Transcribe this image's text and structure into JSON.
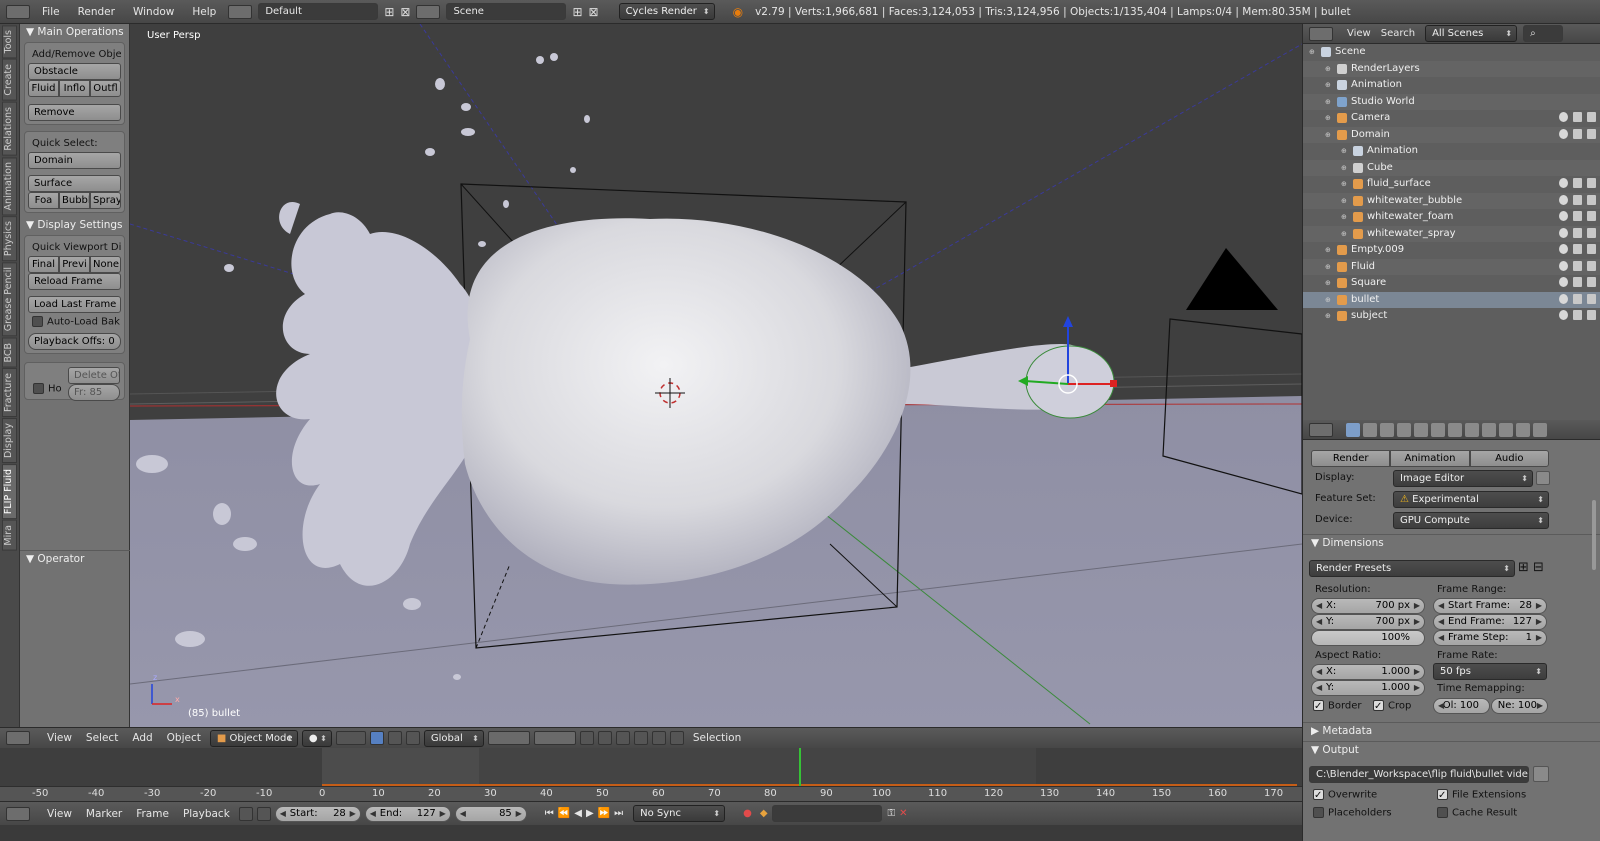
{
  "topbar": {
    "menus": [
      "File",
      "Render",
      "Window",
      "Help"
    ],
    "layout": "Default",
    "scene": "Scene",
    "engine": "Cycles Render",
    "stats": "v2.79 | Verts:1,966,681 | Faces:3,124,053 | Tris:3,124,956 | Objects:1/135,404 | Lamps:0/4 | Mem:80.35M | bullet"
  },
  "tabs": [
    "Tools",
    "Create",
    "Relations",
    "Animation",
    "Physics",
    "Grease Pencil",
    "BCB",
    "Fracture",
    "Display",
    "FLIP Fluid",
    "Mira"
  ],
  "toolshelf": {
    "main_ops": "Main Operations",
    "add_remove": "Add/Remove Objec...",
    "obstacle": "Obstacle",
    "fluid": "Fluid",
    "inflow": "Inflo",
    "outflow": "Outfl",
    "remove": "Remove",
    "quick_select": "Quick Select:",
    "domain": "Domain",
    "surface": "Surface",
    "foam": "Foa",
    "bubble": "Bubbl",
    "spray": "Spray",
    "display_settings": "Display Settings",
    "quick_viewport": "Quick Viewport Dis...",
    "final": "Final",
    "preview": "Previ",
    "none": "None",
    "reload_frame": "Reload Frame",
    "load_last": "Load Last Frame",
    "auto_load": "Auto-Load Bak...",
    "playback_offset": "Playback Offs: 0",
    "delete_ot": "Delete Ot",
    "ho": "Ho",
    "fr": "Fr: 85",
    "operator": "Operator"
  },
  "viewport": {
    "persp_label": "User Persp",
    "frame_label": "(85) bullet",
    "axis_z": "z",
    "axis_x": "x"
  },
  "vp_header": {
    "menus": [
      "View",
      "Select",
      "Add",
      "Object"
    ],
    "mode": "Object Mode",
    "orientation": "Global",
    "selection": "Selection"
  },
  "timeline": {
    "ticks": [
      "-50",
      "-40",
      "-30",
      "-20",
      "-10",
      "0",
      "10",
      "20",
      "30",
      "40",
      "50",
      "60",
      "70",
      "80",
      "90",
      "100",
      "110",
      "120",
      "130",
      "140",
      "150",
      "160",
      "170"
    ],
    "current_frame": 85
  },
  "tl_header": {
    "menus": [
      "View",
      "Marker",
      "Frame",
      "Playback"
    ],
    "start_label": "Start:",
    "start": "28",
    "end_label": "End:",
    "end": "127",
    "current": "85",
    "sync": "No Sync"
  },
  "outliner": {
    "menus": [
      "View",
      "Search"
    ],
    "scenes": "All Scenes",
    "items": [
      {
        "name": "Scene",
        "indent": 0,
        "icon_color": "#c9d3e0"
      },
      {
        "name": "RenderLayers",
        "indent": 1,
        "icon_color": "#d0d0d0"
      },
      {
        "name": "Animation",
        "indent": 1,
        "icon_color": "#c9d3e0"
      },
      {
        "name": "Studio World",
        "indent": 1,
        "icon_color": "#7fa3cc"
      },
      {
        "name": "Camera",
        "indent": 1,
        "icon_color": "#e39b4b"
      },
      {
        "name": "Domain",
        "indent": 1,
        "icon_color": "#e39b4b"
      },
      {
        "name": "Animation",
        "indent": 2,
        "icon_color": "#c9d3e0"
      },
      {
        "name": "Cube",
        "indent": 2,
        "icon_color": "#d0d0d0"
      },
      {
        "name": "fluid_surface",
        "indent": 2,
        "icon_color": "#e39b4b"
      },
      {
        "name": "whitewater_bubble",
        "indent": 2,
        "icon_color": "#e39b4b"
      },
      {
        "name": "whitewater_foam",
        "indent": 2,
        "icon_color": "#e39b4b"
      },
      {
        "name": "whitewater_spray",
        "indent": 2,
        "icon_color": "#e39b4b"
      },
      {
        "name": "Empty.009",
        "indent": 1,
        "icon_color": "#e39b4b"
      },
      {
        "name": "Fluid",
        "indent": 1,
        "icon_color": "#e39b4b"
      },
      {
        "name": "Square",
        "indent": 1,
        "icon_color": "#e39b4b"
      },
      {
        "name": "bullet",
        "indent": 1,
        "icon_color": "#e39b4b"
      },
      {
        "name": "subject",
        "indent": 1,
        "icon_color": "#e39b4b"
      }
    ]
  },
  "properties": {
    "tab_render": "Render",
    "tab_animation": "Animation",
    "tab_audio": "Audio",
    "display_label": "Display:",
    "display_value": "Image Editor",
    "feature_label": "Feature Set:",
    "feature_value": "Experimental",
    "device_label": "Device:",
    "device_value": "GPU Compute",
    "dimensions": "Dimensions",
    "render_presets": "Render Presets",
    "resolution": "Resolution:",
    "res_x_label": "X:",
    "res_x": "700 px",
    "res_y_label": "Y:",
    "res_y": "700 px",
    "res_pct": "100%",
    "frame_range": "Frame Range:",
    "start_frame_label": "Start Frame:",
    "start_frame": "28",
    "end_frame_label": "End Frame:",
    "end_frame": "127",
    "frame_step_label": "Frame Step:",
    "frame_step": "1",
    "aspect_ratio": "Aspect Ratio:",
    "asp_x_label": "X:",
    "asp_x": "1.000",
    "asp_y_label": "Y:",
    "asp_y": "1.000",
    "frame_rate": "Frame Rate:",
    "fps": "50 fps",
    "time_remapping": "Time Remapping:",
    "border": "Border",
    "crop": "Crop",
    "ol_val": "Ol: 100",
    "ne_val": "Ne: 100",
    "metadata": "Metadata",
    "output": "Output",
    "output_path": "C:\\Blender_Workspace\\flip fluid\\bullet video\\slow ...",
    "overwrite": "Overwrite",
    "file_extensions": "File Extensions",
    "placeholders": "Placeholders",
    "cache_result": "Cache Result"
  }
}
